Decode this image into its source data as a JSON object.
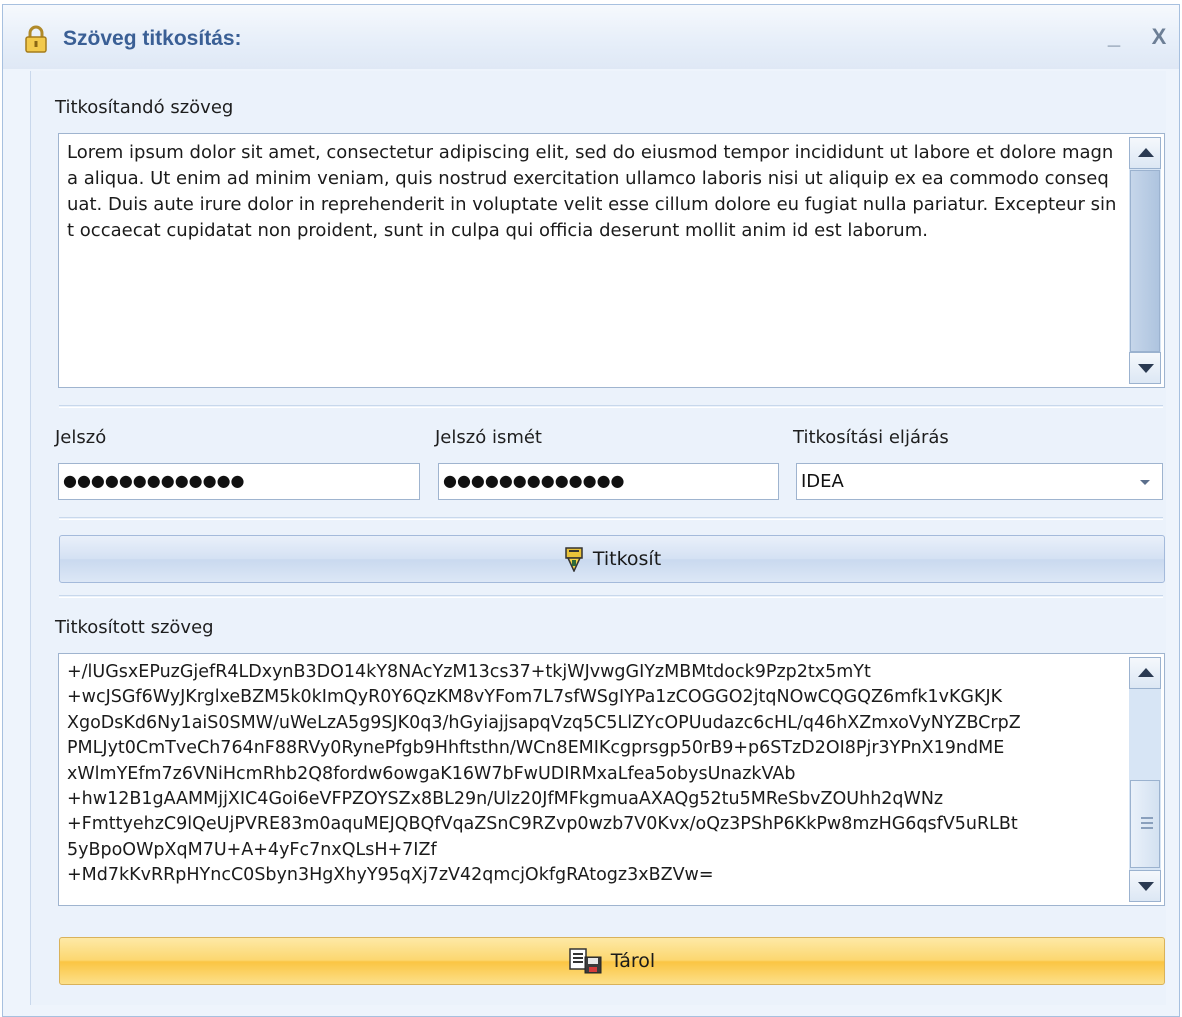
{
  "window": {
    "title": "Szöveg titkosítás:",
    "minimize_label": "_",
    "close_label": "X"
  },
  "plain": {
    "label": "Titkosítandó szöveg",
    "text": "Lorem ipsum dolor sit amet, consectetur adipiscing elit, sed do eiusmod tempor incididunt ut labore et dolore magna aliqua. Ut enim ad minim veniam, quis nostrud exercitation ullamco laboris nisi ut aliquip ex ea commodo consequat. Duis aute irure dolor in reprehenderit in voluptate velit esse cillum dolore eu fugiat nulla pariatur. Excepteur sint occaecat cupidatat non proident, sunt in culpa qui officia deserunt mollit anim id est laborum."
  },
  "password": {
    "label": "Jelszó",
    "masked_value": "●●●●●●●●●●●●●"
  },
  "password_repeat": {
    "label": "Jelszó ismét",
    "masked_value": "●●●●●●●●●●●●●"
  },
  "method": {
    "label": "Titkosítási eljárás",
    "selected": "IDEA"
  },
  "encrypt_button": {
    "label": "Titkosít",
    "icon": "encrypt-icon"
  },
  "cipher": {
    "label": "Titkosított szöveg",
    "text": "+/lUGsxEPuzGjefR4LDxynB3DO14kY8NAcYzM13cs37+tkjWJvwgGIYzMBMtdock9Pzp2tx5mYt\n+wcJSGf6WyJKrglxeBZM5k0kImQyR0Y6QzKM8vYFom7L7sfWSgIYPa1zCOGGO2jtqNOwCQGQZ6mfk1vKGKJK\nXgoDsKd6Ny1aiS0SMW/uWeLzA5g9SJK0q3/hGyiajjsapqVzq5C5LlZYcOPUudazc6cHL/q46hXZmxoVyNYZBCrpZ\nPMLJyt0CmTveCh764nF88RVy0RynePfgb9Hhftsthn/WCn8EMIKcgprsgp50rB9+p6STzD2OI8Pjr3YPnX19ndME\nxWlmYEfm7z6VNiHcmRhb2Q8fordw6owgaK16W7bFwUDIRMxaLfea5obysUnazkVAb\n+hw12B1gAAMMjjXIC4Goi6eVFPZOYSZx8BL29n/Ulz20JfMFkgmuaAXAQg52tu5MReSbvZOUhh2qWNz\n+FmttyehzC9lQeUjPVRE83m0aquMEJQBQfVqaZSnC9RZvp0wzb7V0Kvx/oQz3PShP6KkPw8mzHG6qsfV5uRLBt\n5yBpoOWpXqM7U+A+4yFc7nxQLsH+7IZf\n+Md7kKvRRpHYncC0Sbyn3HgXhyY95qXj7zV42qmcjOkfgRAtogz3xBZVw="
  },
  "store_button": {
    "label": "Tárol",
    "icon": "save-document-icon"
  }
}
